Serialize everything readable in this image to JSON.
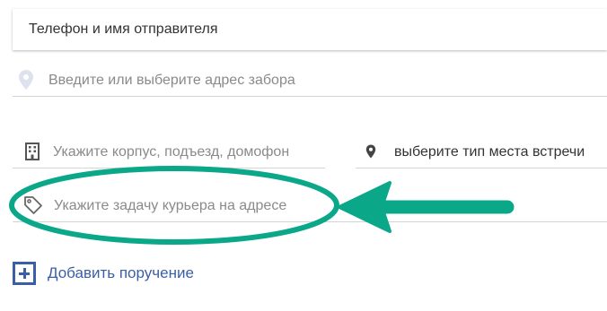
{
  "sender": {
    "label": "Телефон и имя отправителя"
  },
  "pickup": {
    "address_placeholder": "Введите или выберите адрес забора",
    "building_placeholder": "Укажите корпус, подъезд, домофон",
    "meeting_place_value": "выберите тип места встречи",
    "task_placeholder": "Укажите задачу курьера на адресе"
  },
  "actions": {
    "add_assignment": "Добавить поручение"
  },
  "icons": {
    "address": "map-pin-icon",
    "building": "building-icon",
    "meeting_place": "location-pin-icon",
    "task": "tag-icon",
    "add": "plus-square-icon"
  },
  "colors": {
    "annotation": "#0aa889",
    "link": "#3b5ea8",
    "placeholder": "#8a8a8a",
    "text": "#333333"
  }
}
